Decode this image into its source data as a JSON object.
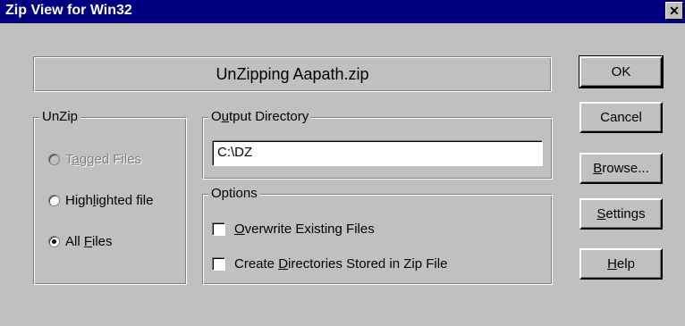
{
  "window": {
    "title": "Zip View for Win32",
    "close_glyph": "✕"
  },
  "banner": {
    "text": "UnZipping Aapath.zip"
  },
  "buttons": {
    "ok": {
      "label": "OK"
    },
    "cancel": {
      "label": "Cancel"
    },
    "browse": {
      "pre": "",
      "mnemonic": "B",
      "post": "rowse..."
    },
    "settings": {
      "pre": "",
      "mnemonic": "S",
      "post": "ettings"
    },
    "help": {
      "pre": "",
      "mnemonic": "H",
      "post": "elp"
    }
  },
  "unzip": {
    "label": "UnZip",
    "options": [
      {
        "pre": "T",
        "mnemonic": "a",
        "post": "gged Files",
        "checked": false,
        "disabled": true
      },
      {
        "pre": "High",
        "mnemonic": "l",
        "post": "ighted file",
        "checked": false,
        "disabled": false
      },
      {
        "pre": "All ",
        "mnemonic": "F",
        "post": "iles",
        "checked": true,
        "disabled": false
      }
    ]
  },
  "output": {
    "label": {
      "pre": "O",
      "mnemonic": "u",
      "post": "tput Directory"
    },
    "value": "C:\\DZ"
  },
  "options": {
    "label": "Options",
    "items": [
      {
        "pre": "",
        "mnemonic": "O",
        "post": "verwrite Existing Files",
        "checked": false
      },
      {
        "pre": "Create ",
        "mnemonic": "D",
        "post": "irectories Stored in Zip File",
        "checked": false
      }
    ]
  }
}
